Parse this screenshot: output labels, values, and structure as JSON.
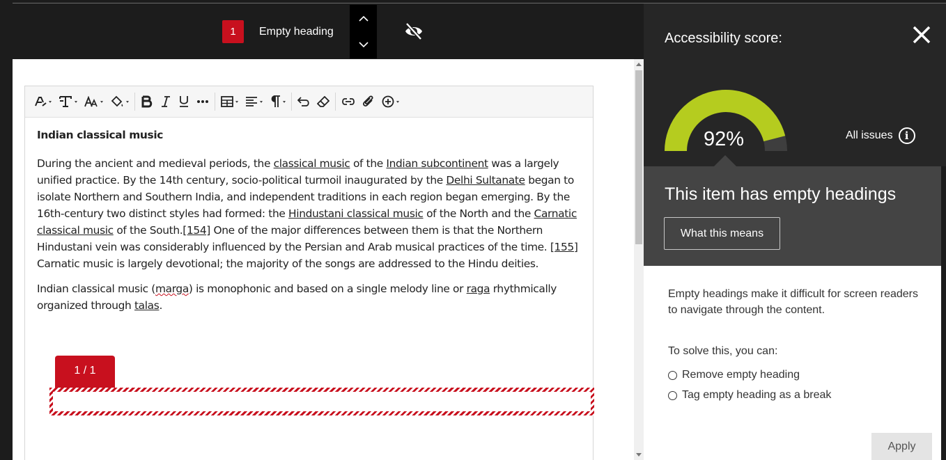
{
  "issue_bar": {
    "issue_number": "1",
    "issue_label": "Empty heading",
    "prev_icon": "chevron-up-icon",
    "next_icon": "chevron-down-icon",
    "visibility_icon": "eye-slash-icon"
  },
  "toolbar": {
    "items": [
      "text-style",
      "paragraph-format",
      "font-size",
      "text-color",
      "bold",
      "italic",
      "underline",
      "more",
      "table",
      "align",
      "paragraph-marks",
      "undo",
      "clear-format",
      "link",
      "attachment",
      "insert"
    ]
  },
  "document": {
    "heading": "Indian classical music",
    "p1": {
      "t1": "During the ancient and medieval periods, the ",
      "l1": "classical music",
      "t2": " of the ",
      "l2": "Indian subcontinent",
      "t3": " was a largely unified practice. By the 14th century, socio-political turmoil inaugurated by the ",
      "l3": "Delhi Sultanate",
      "t4": " began to isolate Northern and Southern India, and independent traditions in each region began emerging. By the 16th-century two distinct styles had formed: the ",
      "l4": "Hindustani classical music",
      "t5": " of the North and the ",
      "l5": "Carnatic classical music",
      "t6": " of the South.",
      "l6": "[154]",
      "t7": " One of the major differences between them is that the Northern Hindustani vein was considerably influenced by the Persian and Arab musical practices of the time. ",
      "l7": "[155]",
      "t8": " Carnatic music is largely devotional; the majority of the songs are addressed to the Hindu deities."
    },
    "p2": {
      "t1": "Indian classical music (",
      "l1": "marga",
      "t2": ") is monophonic and based on a single melody line or ",
      "l2": "raga",
      "t3": " rhythmically organized through ",
      "l3": "talas",
      "t4": "."
    },
    "page_indicator": "1 / 1"
  },
  "panel": {
    "title": "Accessibility score:",
    "score": "92%",
    "score_fraction": 0.92,
    "all_issues": "All issues",
    "info_glyph": "i",
    "issue_title": "This item has empty headings",
    "what_this_means": "What this means",
    "description": "Empty headings make it difficult for screen readers to navigate through the content.",
    "solve_intro": "To solve this, you can:",
    "options": [
      "Remove empty heading",
      "Tag empty heading as a break"
    ],
    "apply": "Apply",
    "colors": {
      "gauge_fill": "#b5cc1f",
      "gauge_track": "#3e3e3e",
      "issue_red": "#c8101e"
    }
  }
}
